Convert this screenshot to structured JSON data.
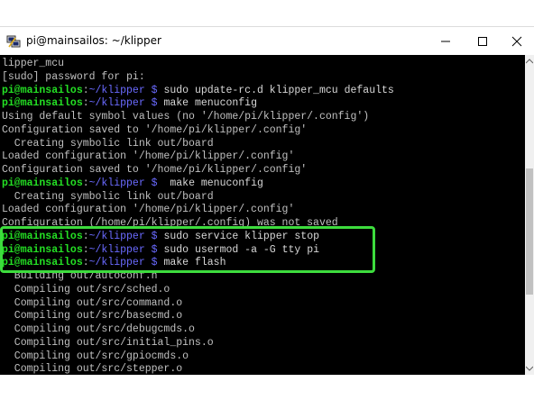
{
  "window": {
    "title": "pi@mainsailos: ~/klipper",
    "icon": "putty-icon",
    "controls": {
      "minimize": "minimize-icon",
      "maximize": "maximize-icon",
      "close": "close-icon"
    }
  },
  "colors": {
    "prompt_user": "#24e024",
    "prompt_path": "#6a6aff",
    "text": "#c0c0c0",
    "highlight": "#3ddc3d",
    "background": "#000000"
  },
  "prompt": {
    "user_host": "pi@mainsailos",
    "sep": ":",
    "path": "~/klipper",
    "dollar": " $ "
  },
  "terminal": {
    "lines": [
      {
        "type": "text",
        "text": "lipper_mcu"
      },
      {
        "type": "text",
        "text": "[sudo] password for pi:"
      },
      {
        "type": "prompt",
        "cmd": "sudo update-rc.d klipper_mcu defaults"
      },
      {
        "type": "prompt",
        "cmd": "make menuconfig"
      },
      {
        "type": "text",
        "text": "Using default symbol values (no '/home/pi/klipper/.config')"
      },
      {
        "type": "text",
        "text": "Configuration saved to '/home/pi/klipper/.config'"
      },
      {
        "type": "text",
        "text": "  Creating symbolic link out/board"
      },
      {
        "type": "text",
        "text": "Loaded configuration '/home/pi/klipper/.config'"
      },
      {
        "type": "text",
        "text": "Configuration saved to '/home/pi/klipper/.config'"
      },
      {
        "type": "prompt",
        "cmd": " make menuconfig"
      },
      {
        "type": "text",
        "text": "  Creating symbolic link out/board"
      },
      {
        "type": "text",
        "text": "Loaded configuration '/home/pi/klipper/.config'"
      },
      {
        "type": "text",
        "text": "Configuration (/home/pi/klipper/.config) was not saved"
      },
      {
        "type": "prompt",
        "cmd": "sudo service klipper stop"
      },
      {
        "type": "prompt",
        "cmd": "sudo usermod -a -G tty pi"
      },
      {
        "type": "prompt",
        "cmd": "make flash"
      },
      {
        "type": "text",
        "text": "  Building out/autoconf.h"
      },
      {
        "type": "text",
        "text": "  Compiling out/src/sched.o"
      },
      {
        "type": "text",
        "text": "  Compiling out/src/command.o"
      },
      {
        "type": "text",
        "text": "  Compiling out/src/basecmd.o"
      },
      {
        "type": "text",
        "text": "  Compiling out/src/debugcmds.o"
      },
      {
        "type": "text",
        "text": "  Compiling out/src/initial_pins.o"
      },
      {
        "type": "text",
        "text": "  Compiling out/src/gpiocmds.o"
      },
      {
        "type": "text",
        "text": "  Compiling out/src/stepper.o"
      }
    ]
  }
}
